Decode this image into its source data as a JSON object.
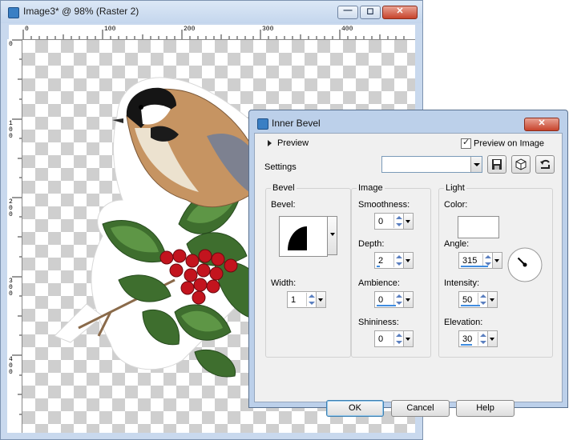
{
  "image_window": {
    "title": "Image3* @  98% (Raster 2)",
    "ruler_top_labels": [
      "0",
      "100",
      "200",
      "300",
      "400"
    ],
    "ruler_left_labels": [
      "0",
      "100",
      "200",
      "300",
      "400"
    ]
  },
  "dialog": {
    "title": "Inner Bevel",
    "preview_label": "Preview",
    "preview_on_image_label": "Preview on Image",
    "preview_on_image_checked": true,
    "settings_label": "Settings",
    "settings_value": "",
    "bevel_group": {
      "title": "Bevel",
      "bevel_label": "Bevel:",
      "width_label": "Width:",
      "width_value": "1"
    },
    "image_group": {
      "title": "Image",
      "smoothness_label": "Smoothness:",
      "smoothness_value": "0",
      "depth_label": "Depth:",
      "depth_value": "2",
      "ambience_label": "Ambience:",
      "ambience_value": "0",
      "shininess_label": "Shininess:",
      "shininess_value": "0"
    },
    "light_group": {
      "title": "Light",
      "color_label": "Color:",
      "color_value": "#ffffff",
      "angle_label": "Angle:",
      "angle_value": "315",
      "intensity_label": "Intensity:",
      "intensity_value": "50",
      "elevation_label": "Elevation:",
      "elevation_value": "30"
    },
    "buttons": {
      "ok": "OK",
      "cancel": "Cancel",
      "help": "Help"
    }
  },
  "icons": {
    "window_icon": "paint-shop-pro-icon",
    "minimize": "minimize-icon",
    "maximize": "maximize-icon",
    "close": "close-icon",
    "save_preset": "save-preset-icon",
    "resource_manager": "resource-manager-icon",
    "reset": "reset-icon"
  },
  "colors": {
    "accent": "#3f8ce0",
    "title_bg": "#bcd0ea"
  }
}
